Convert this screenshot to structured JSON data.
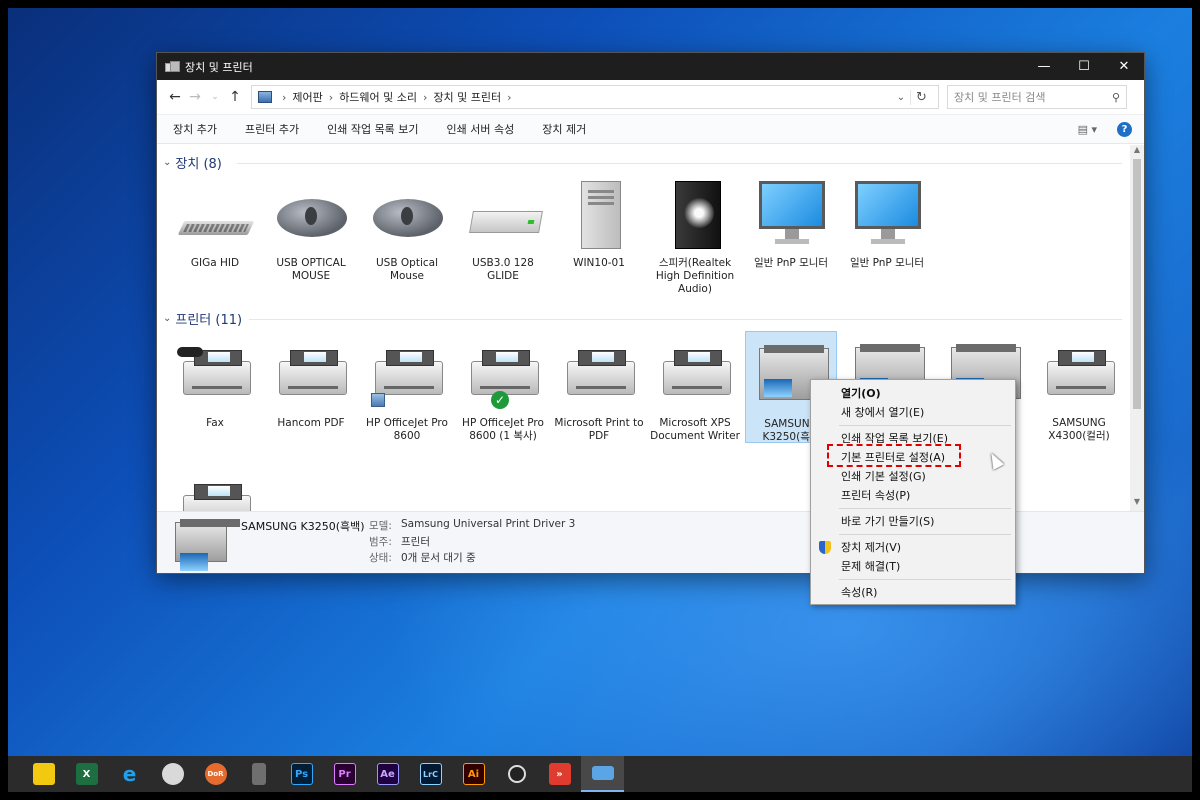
{
  "window": {
    "title": "장치 및 프린터",
    "controls": {
      "minimize": "—",
      "maximize": "☐",
      "close": "✕"
    }
  },
  "address": {
    "path": [
      "제어판",
      "하드웨어 및 소리",
      "장치 및 프린터"
    ],
    "search_placeholder": "장치 및 프린터 검색"
  },
  "toolbar": {
    "items": [
      "장치 추가",
      "프린터 추가",
      "인쇄 작업 목록 보기",
      "인쇄 서버 속성",
      "장치 제거"
    ],
    "help": "?"
  },
  "groups": {
    "devices": {
      "label": "장치 (8)"
    },
    "printers": {
      "label": "프린터 (11)"
    }
  },
  "devices": [
    {
      "label": "GIGa HID",
      "icon": "keyboard-icon"
    },
    {
      "label": "USB OPTICAL MOUSE",
      "icon": "mouse-icon"
    },
    {
      "label": "USB Optical Mouse",
      "icon": "mouse-icon"
    },
    {
      "label": "USB3.0 128 GLIDE",
      "icon": "usb-drive-icon"
    },
    {
      "label": "WIN10-01",
      "icon": "computer-tower-icon"
    },
    {
      "label": "스피커(Realtek High Definition Audio)",
      "icon": "speaker-icon"
    },
    {
      "label": "일반 PnP 모니터",
      "icon": "monitor-icon"
    },
    {
      "label": "일반 PnP 모니터",
      "icon": "monitor-icon"
    }
  ],
  "printers": [
    {
      "label": "Fax",
      "icon": "fax-icon"
    },
    {
      "label": "Hancom PDF",
      "icon": "printer-icon"
    },
    {
      "label": "HP OfficeJet Pro 8600",
      "icon": "printer-icon"
    },
    {
      "label": "HP OfficeJet Pro 8600 (1 복사)",
      "icon": "printer-icon"
    },
    {
      "label": "Microsoft Print to PDF",
      "icon": "printer-icon"
    },
    {
      "label": "Microsoft XPS Document Writer",
      "icon": "printer-icon"
    },
    {
      "label": "SAMSUNG K3250(흑백",
      "icon": "multifunction-printer-icon"
    },
    {
      "label": "",
      "icon": "multifunction-printer-icon"
    },
    {
      "label": "",
      "icon": "multifunction-printer-icon"
    },
    {
      "label": "SAMSUNG X4300(컬러)",
      "icon": "printer-icon"
    },
    {
      "label": "",
      "icon": "multifunction-printer-icon"
    }
  ],
  "details": {
    "name": "SAMSUNG K3250(흑백)",
    "rows": [
      {
        "key": "모델:",
        "value": "Samsung Universal Print Driver 3"
      },
      {
        "key": "범주:",
        "value": "프린터"
      },
      {
        "key": "상태:",
        "value": "0개 문서 대기 중"
      }
    ]
  },
  "context_menu": {
    "items": [
      "열기(O)",
      "새 창에서 열기(E)",
      "인쇄 작업 목록 보기(E)",
      "기본 프린터로 설정(A)",
      "인쇄 기본 설정(G)",
      "프린터 속성(P)",
      "바로 가기 만들기(S)",
      "장치 제거(V)",
      "문제 해결(T)",
      "속성(R)"
    ],
    "highlighted": "기본 프린터로 설정(A)"
  },
  "taskbar": {
    "apps": [
      {
        "name": "sticky-notes",
        "label": "",
        "color": "#f2c811"
      },
      {
        "name": "excel",
        "label": "X",
        "color": "#1d6f42"
      },
      {
        "name": "internet-explorer",
        "label": "e",
        "color": "#1ea0ef"
      },
      {
        "name": "paint",
        "label": "",
        "color": "#d9d9d9"
      },
      {
        "name": "daum-potplayer",
        "label": "DoR",
        "color": "#e66b2e"
      },
      {
        "name": "calculator",
        "label": "",
        "color": "#6f6f6f"
      },
      {
        "name": "photoshop",
        "label": "Ps",
        "color": "#001e36"
      },
      {
        "name": "premiere",
        "label": "Pr",
        "color": "#2a0033"
      },
      {
        "name": "after-effects",
        "label": "Ae",
        "color": "#1f0040"
      },
      {
        "name": "lightroom-classic",
        "label": "LrC",
        "color": "#001a33"
      },
      {
        "name": "illustrator",
        "label": "Ai",
        "color": "#330000"
      },
      {
        "name": "obs",
        "label": "",
        "color": "#3a3a3a"
      },
      {
        "name": "app-red",
        "label": "",
        "color": "#e03b2f"
      },
      {
        "name": "control-panel",
        "label": "",
        "color": "#5ba5e6"
      }
    ]
  }
}
